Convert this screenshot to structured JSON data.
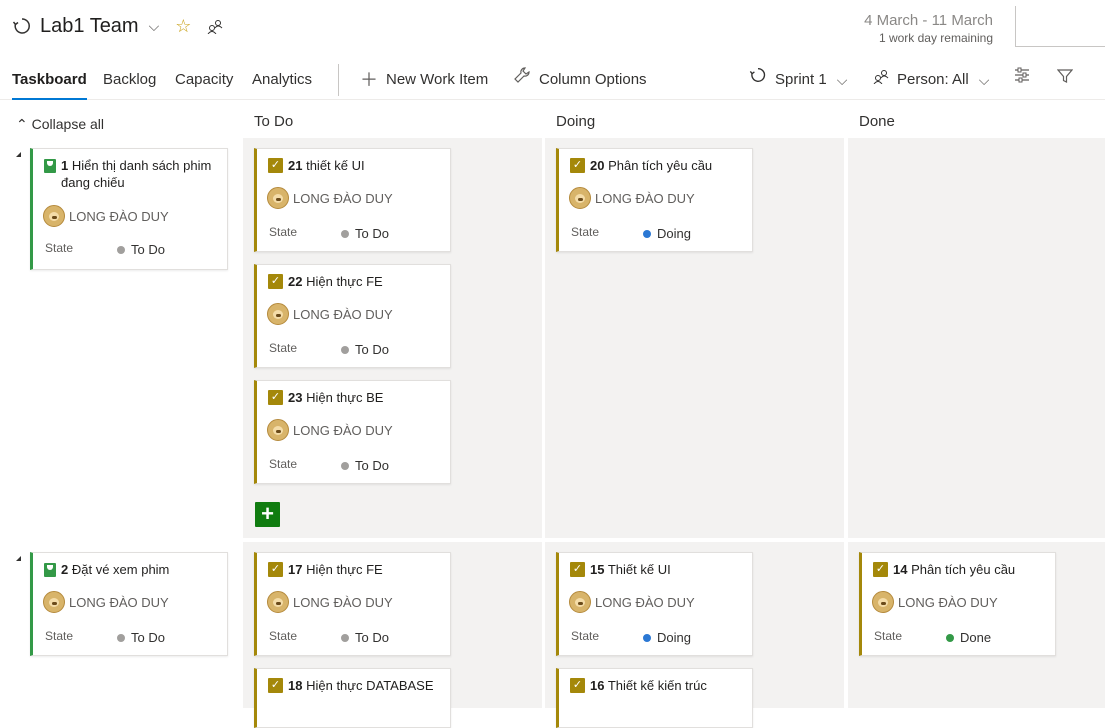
{
  "header": {
    "team_name": "Lab1 Team",
    "sprint_dates": "4 March - 11 March",
    "remaining": "1 work day remaining"
  },
  "nav": {
    "tabs": [
      "Taskboard",
      "Backlog",
      "Capacity",
      "Analytics"
    ],
    "active_tab": "Taskboard",
    "new_work_item": "New Work Item",
    "column_options": "Column Options",
    "sprint": "Sprint 1",
    "person": "Person: All"
  },
  "board": {
    "collapse_all": "Collapse all",
    "columns": [
      "To Do",
      "Doing",
      "Done"
    ],
    "state_label": "State",
    "colors": {
      "todo": "#a19f9d",
      "doing": "#2b78d4",
      "done": "#339947",
      "task": "#a4880a",
      "pbi": "#339947"
    },
    "rows": [
      {
        "pbi": {
          "id": "1",
          "title": "Hiển thị danh sách phim đang chiếu",
          "assignee": "LONG ĐÀO DUY",
          "state": "To Do"
        },
        "todo": [
          {
            "id": "21",
            "title": "thiết kế UI",
            "assignee": "LONG ĐÀO DUY",
            "state": "To Do"
          },
          {
            "id": "22",
            "title": "Hiện thực FE",
            "assignee": "LONG ĐÀO DUY",
            "state": "To Do"
          },
          {
            "id": "23",
            "title": "Hiện thực BE",
            "assignee": "LONG ĐÀO DUY",
            "state": "To Do"
          }
        ],
        "doing": [
          {
            "id": "20",
            "title": "Phân tích yêu cầu",
            "assignee": "LONG ĐÀO DUY",
            "state": "Doing"
          }
        ],
        "done": []
      },
      {
        "pbi": {
          "id": "2",
          "title": "Đặt vé xem phim",
          "assignee": "LONG ĐÀO DUY",
          "state": "To Do"
        },
        "todo": [
          {
            "id": "17",
            "title": "Hiện thực FE",
            "assignee": "LONG ĐÀO DUY",
            "state": "To Do"
          },
          {
            "id": "18",
            "title": "Hiện thực DATABASE",
            "assignee": "",
            "state": ""
          }
        ],
        "doing": [
          {
            "id": "15",
            "title": "Thiết kế UI",
            "assignee": "LONG ĐÀO DUY",
            "state": "Doing"
          },
          {
            "id": "16",
            "title": "Thiết kế kiến trúc",
            "assignee": "",
            "state": ""
          }
        ],
        "done": [
          {
            "id": "14",
            "title": "Phân tích yêu cầu",
            "assignee": "LONG ĐÀO DUY",
            "state": "Done"
          }
        ]
      }
    ]
  }
}
